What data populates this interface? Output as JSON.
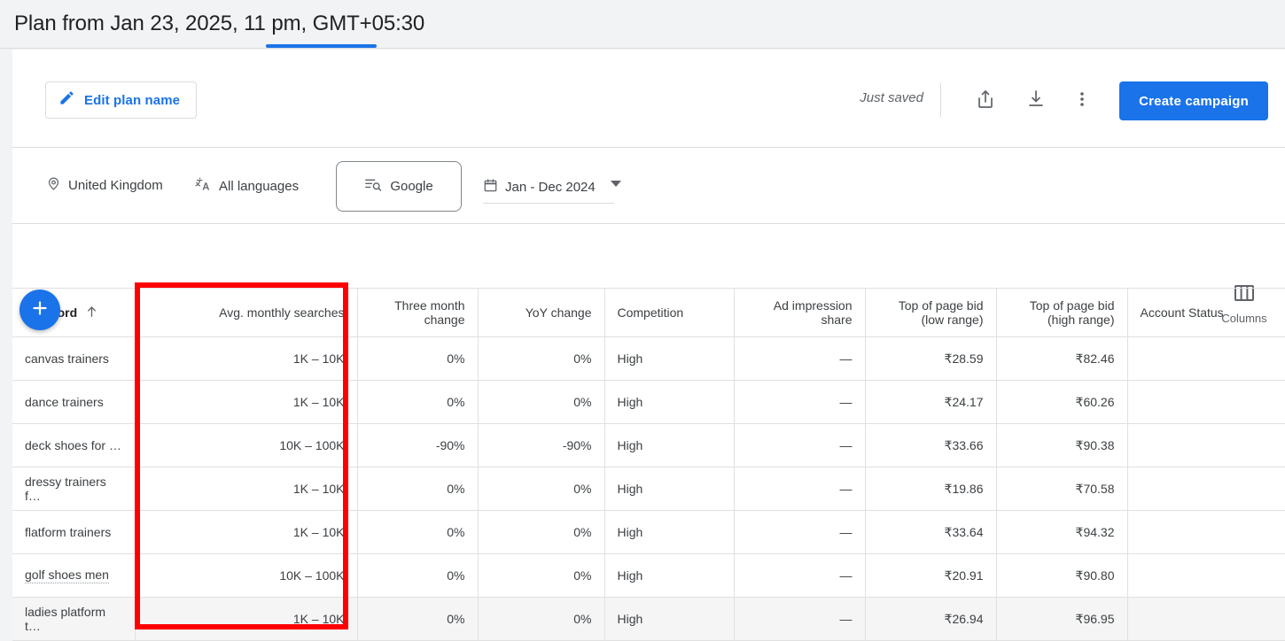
{
  "header": {
    "title": "Plan from Jan 23, 2025, 11 pm, GMT+05:30"
  },
  "toolbar": {
    "edit_plan_name_label": "Edit plan name",
    "edit_icon": "pencil-icon",
    "save_status": "Just saved",
    "share_icon": "share-icon",
    "download_icon": "download-icon",
    "more_icon": "more-vert-icon",
    "create_campaign_label": "Create campaign",
    "accent_color": "#1a73e8"
  },
  "filters": {
    "location": {
      "icon": "location-pin-icon",
      "label": "United Kingdom"
    },
    "language": {
      "icon": "translate-icon",
      "label": "All languages"
    },
    "network": {
      "icon": "search-list-icon",
      "label": "Google"
    },
    "date_range": {
      "icon": "calendar-icon",
      "label": "Jan - Dec 2024"
    }
  },
  "table_controls": {
    "add_label": "+",
    "add_icon": "plus-icon",
    "columns_label": "Columns",
    "columns_icon": "columns-icon"
  },
  "table": {
    "columns": [
      {
        "label": "Keyword",
        "sorted": true,
        "sort_icon": "arrow-up-icon",
        "align": "left"
      },
      {
        "label": "Avg. monthly searches",
        "align": "right"
      },
      {
        "label": "Three month change",
        "align": "right"
      },
      {
        "label": "YoY change",
        "align": "right"
      },
      {
        "label": "Competition",
        "align": "left"
      },
      {
        "label": "Ad impression share",
        "align": "right"
      },
      {
        "label": "Top of page bid (low range)",
        "align": "right"
      },
      {
        "label": "Top of page bid (high range)",
        "align": "right"
      },
      {
        "label": "Account Status",
        "align": "left"
      }
    ],
    "rows": [
      {
        "keyword": "canvas trainers",
        "hinted": false,
        "avg_monthly_searches": "1K – 10K",
        "three_month_change": "0%",
        "yoy_change": "0%",
        "competition": "High",
        "ad_impression_share": "—",
        "top_of_page_bid_low": "₹28.59",
        "top_of_page_bid_high": "₹82.46",
        "account_status": "",
        "hover": false
      },
      {
        "keyword": "dance trainers",
        "hinted": false,
        "avg_monthly_searches": "1K – 10K",
        "three_month_change": "0%",
        "yoy_change": "0%",
        "competition": "High",
        "ad_impression_share": "—",
        "top_of_page_bid_low": "₹24.17",
        "top_of_page_bid_high": "₹60.26",
        "account_status": "",
        "hover": false
      },
      {
        "keyword": "deck shoes for …",
        "hinted": false,
        "avg_monthly_searches": "10K – 100K",
        "three_month_change": "-90%",
        "yoy_change": "-90%",
        "competition": "High",
        "ad_impression_share": "—",
        "top_of_page_bid_low": "₹33.66",
        "top_of_page_bid_high": "₹90.38",
        "account_status": "",
        "hover": false
      },
      {
        "keyword": "dressy trainers f…",
        "hinted": false,
        "avg_monthly_searches": "1K – 10K",
        "three_month_change": "0%",
        "yoy_change": "0%",
        "competition": "High",
        "ad_impression_share": "—",
        "top_of_page_bid_low": "₹19.86",
        "top_of_page_bid_high": "₹70.58",
        "account_status": "",
        "hover": false
      },
      {
        "keyword": "flatform trainers",
        "hinted": false,
        "avg_monthly_searches": "1K – 10K",
        "three_month_change": "0%",
        "yoy_change": "0%",
        "competition": "High",
        "ad_impression_share": "—",
        "top_of_page_bid_low": "₹33.64",
        "top_of_page_bid_high": "₹94.32",
        "account_status": "",
        "hover": false
      },
      {
        "keyword": "golf shoes men",
        "hinted": true,
        "avg_monthly_searches": "10K – 100K",
        "three_month_change": "0%",
        "yoy_change": "0%",
        "competition": "High",
        "ad_impression_share": "—",
        "top_of_page_bid_low": "₹20.91",
        "top_of_page_bid_high": "₹90.80",
        "account_status": "",
        "hover": false
      },
      {
        "keyword": "ladies platform t…",
        "hinted": false,
        "avg_monthly_searches": "1K – 10K",
        "three_month_change": "0%",
        "yoy_change": "0%",
        "competition": "High",
        "ad_impression_share": "—",
        "top_of_page_bid_low": "₹26.94",
        "top_of_page_bid_high": "₹96.95",
        "account_status": "",
        "hover": true
      }
    ]
  },
  "annotation": {
    "type": "highlight-rectangle",
    "color": "#ff0000",
    "targets_column": "Avg. monthly searches"
  }
}
